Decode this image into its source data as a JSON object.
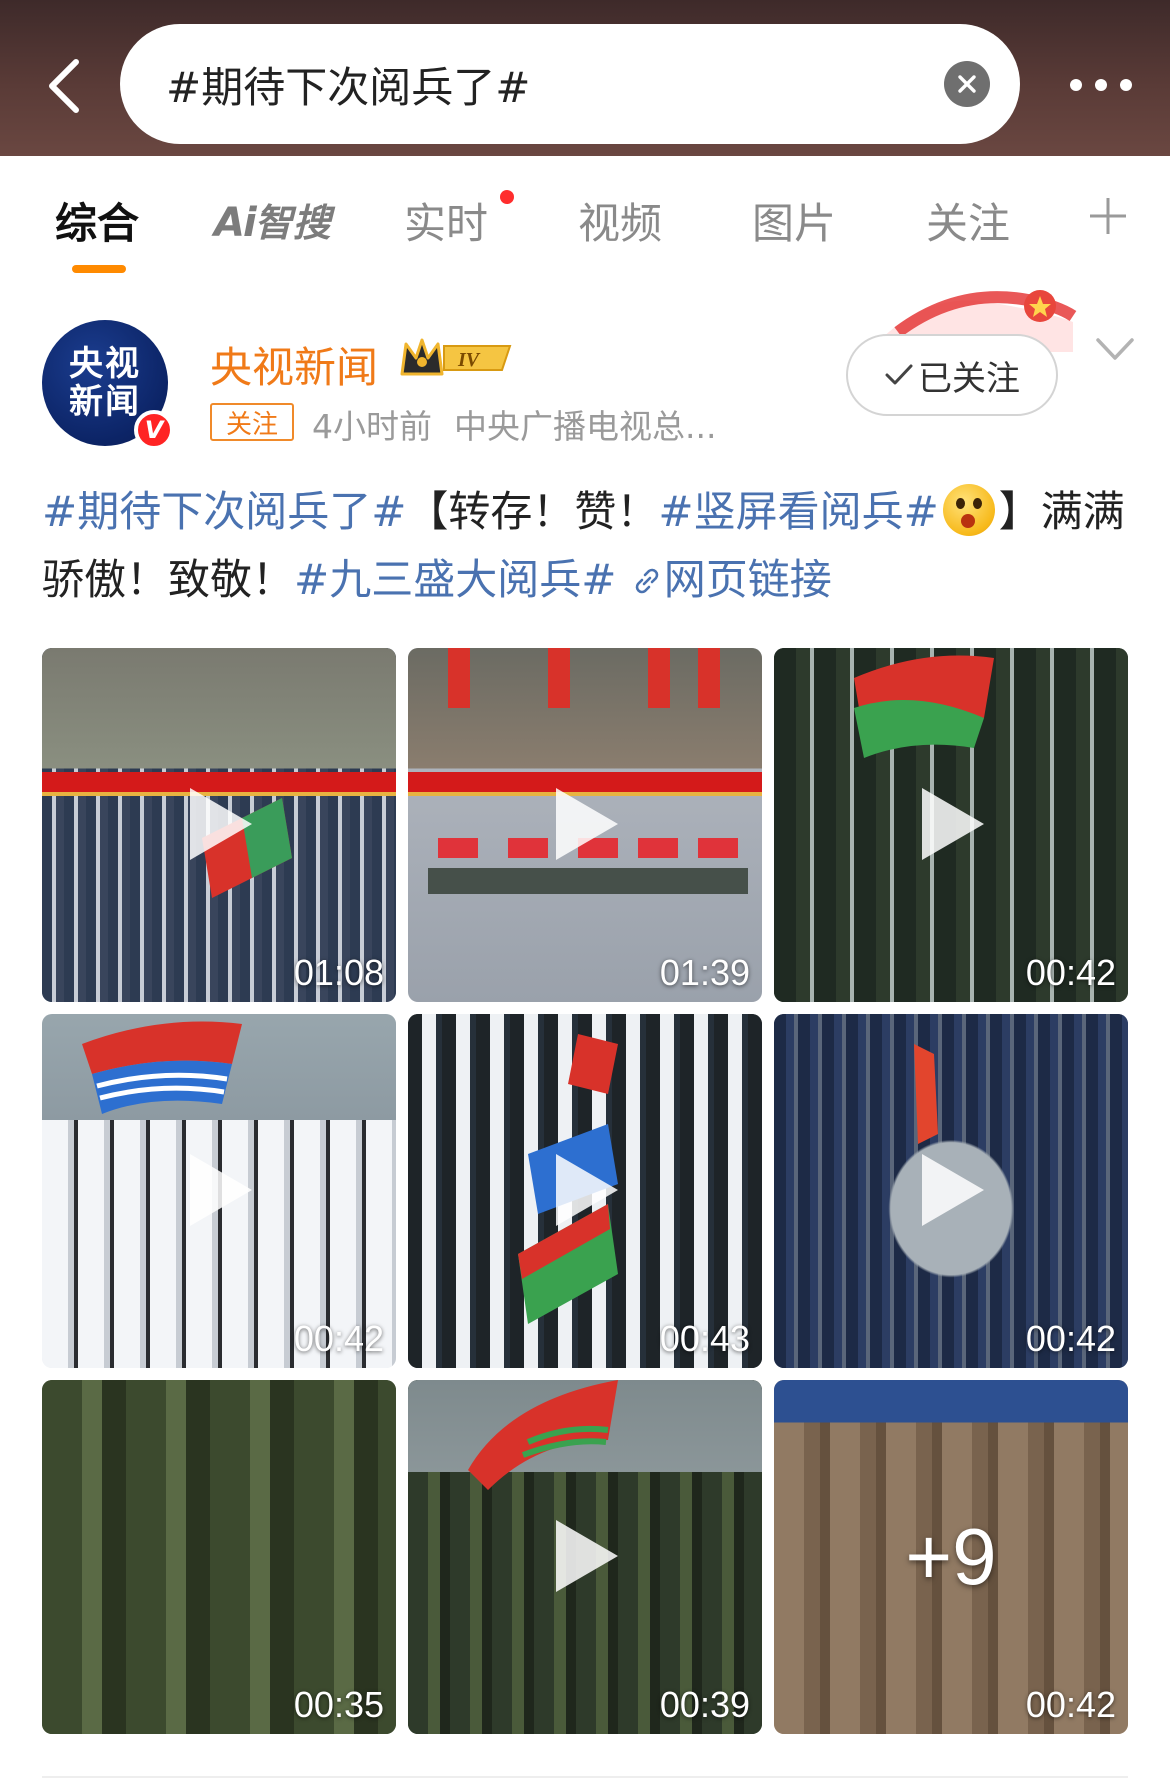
{
  "search": {
    "query": "#期待下次阅兵了#"
  },
  "tabs": [
    {
      "label": "综合",
      "active": true
    },
    {
      "label": "AI智搜"
    },
    {
      "label": "实时",
      "has_dot": true
    },
    {
      "label": "视频"
    },
    {
      "label": "图片"
    },
    {
      "label": "关注"
    }
  ],
  "ai_tab": {
    "ai": "Ai",
    "rest": "智搜"
  },
  "post": {
    "avatar": {
      "line1": "央视",
      "line2": "新闻"
    },
    "author": "央视新闻",
    "level_badge": "IV",
    "follow_tag": "关注",
    "time": "4小时前",
    "source": "中央广播电视总...",
    "followed_button": "已关注",
    "text": {
      "tag1": "#期待下次阅兵了#",
      "t1": "【转存！赞！",
      "tag2": "#竖屏看阅兵#",
      "t2": "】满满骄傲！致敬！",
      "tag3": "#九三盛大阅兵#",
      "link": "网页链接"
    },
    "videos": [
      {
        "duration": "01:08"
      },
      {
        "duration": "01:39"
      },
      {
        "duration": "00:42"
      },
      {
        "duration": "00:42"
      },
      {
        "duration": "00:43"
      },
      {
        "duration": "00:42"
      },
      {
        "duration": "00:35"
      },
      {
        "duration": "00:39"
      },
      {
        "duration": "00:42",
        "more": "+9"
      }
    ]
  },
  "colors": {
    "accent": "#ff8a00",
    "author": "#f07a18",
    "hashtag": "#4a72b0",
    "header_bg": "#4a3230"
  }
}
